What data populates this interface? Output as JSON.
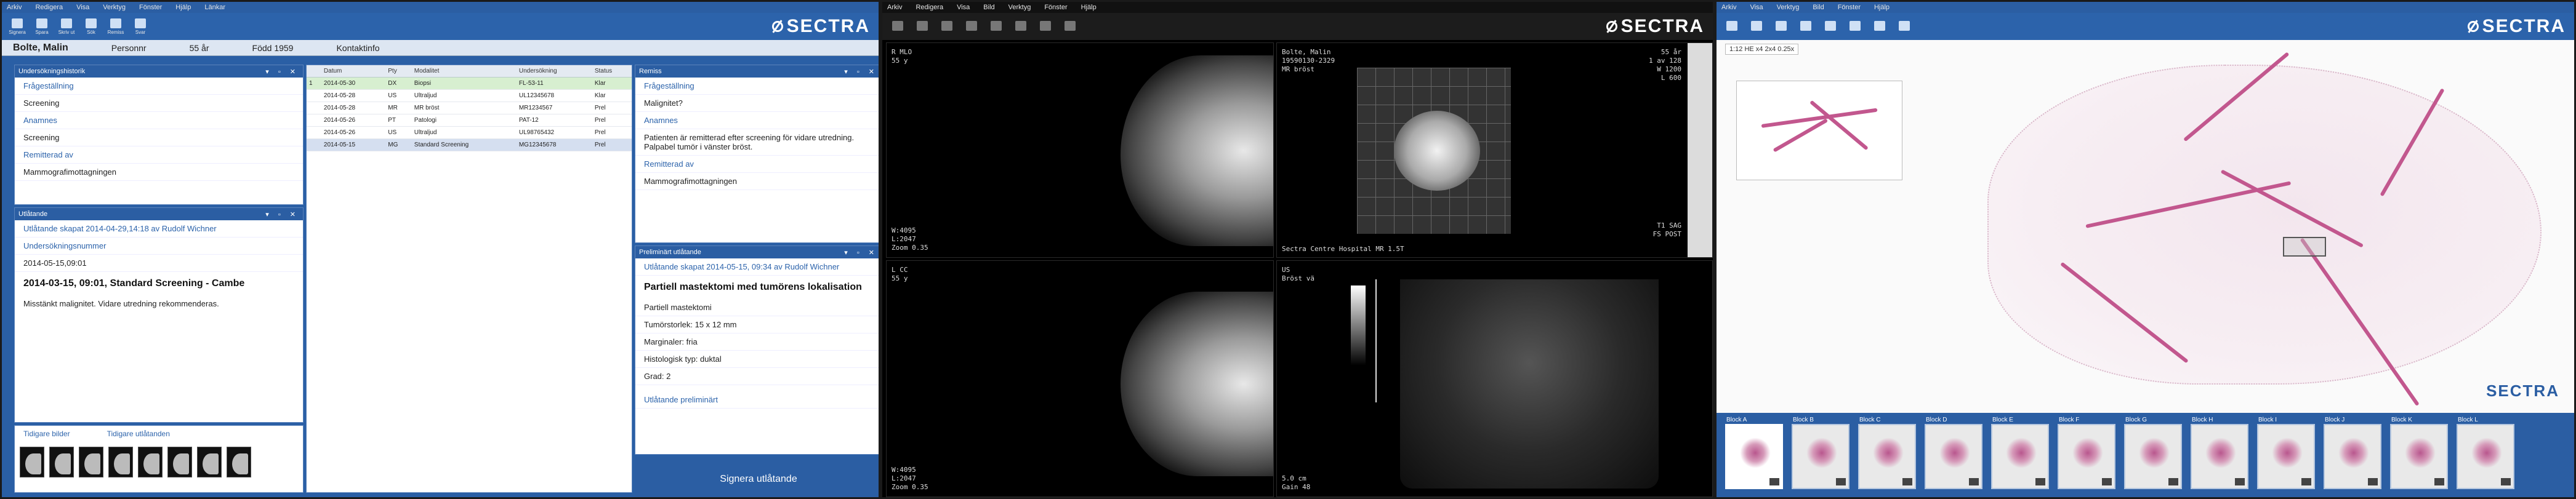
{
  "ris": {
    "menu": [
      "Arkiv",
      "Redigera",
      "Visa",
      "Verktyg",
      "Fönster",
      "Hjälp",
      "Länkar"
    ],
    "toolbar": [
      "Signera",
      "Spara",
      "Skriv ut",
      "Sök",
      "Remiss",
      "Svar"
    ],
    "patient": {
      "name": "Bolte, Malin",
      "id": "Personnr",
      "age": "55 år",
      "born": "Född 1959",
      "extra": "Kontaktinfo"
    },
    "brand": "SECTRA",
    "left_pane": {
      "title": "Undersökningshistorik",
      "items": [
        {
          "label": "Frågeställning",
          "link": true
        },
        {
          "label": "Screening",
          "link": false
        },
        {
          "label": "Anamnes",
          "link": true
        },
        {
          "label": "Screening",
          "link": false
        },
        {
          "label": "Remitterad av",
          "link": true
        },
        {
          "label": "Mammografimottagningen",
          "link": false
        }
      ]
    },
    "report_pane": {
      "title": "Utlåtande",
      "signed_by": "Utlåtande skapat 2014-04-29,14:18 av Rudolf Wichner",
      "exam_label": "Undersökningsnummer",
      "exam_no": "2014-05-15,09:01",
      "heading": "2014-03-15, 09:01, Standard Screening - Cambe",
      "body": "Misstänkt malignitet. Vidare utredning rekommenderas."
    },
    "bottom_pane": {
      "left": "Tidigare bilder",
      "right": "Tidigare utlåtanden"
    },
    "table": {
      "columns": [
        "",
        "Datum",
        "Pty",
        "Modalitet",
        "Undersökning",
        "Status"
      ],
      "rows": [
        [
          "1",
          "2014-05-30",
          "DX",
          "Biopsi",
          "FL-53-11",
          "Klar"
        ],
        [
          "",
          "2014-05-28",
          "US",
          "Ultraljud",
          "UL12345678",
          "Klar"
        ],
        [
          "",
          "2014-05-28",
          "MR",
          "MR bröst",
          "MR1234567",
          "Prel"
        ],
        [
          "",
          "2014-05-26",
          "PT",
          "Patologi",
          "PAT-12",
          "Prel"
        ],
        [
          "",
          "2014-05-26",
          "US",
          "Ultraljud",
          "UL98765432",
          "Prel"
        ],
        [
          "",
          "2014-05-15",
          "MG",
          "Standard Screening",
          "MG12345678",
          "Prel"
        ]
      ]
    },
    "right_pane": {
      "title": "Remiss",
      "items": [
        {
          "label": "Frågeställning",
          "link": true
        },
        {
          "label": "Malignitet?",
          "link": false
        },
        {
          "label": "Anamnes",
          "link": true
        },
        {
          "label": "Patienten är remitterad efter screening för vidare utredning. Palpabel tumör i vänster bröst.",
          "link": false
        },
        {
          "label": "Remitterad av",
          "link": true
        },
        {
          "label": "Mammografimottagningen",
          "link": false
        }
      ]
    },
    "right_report": {
      "title": "Preliminärt utlåtande",
      "subtitle": "Utlåtande skapat 2014-05-15, 09:34 av Rudolf Wichner",
      "heading": "Partiell mastektomi med tumörens lokalisation",
      "lines": [
        "Partiell mastektomi",
        "Tumörstorlek: 15 x 12 mm",
        "Marginaler: fria",
        "Histologisk typ: duktal",
        "Grad: 2"
      ],
      "footer": "Utlåtande preliminärt"
    },
    "sign_button": "Signera utlåtande"
  },
  "pacs": {
    "menu": [
      "Arkiv",
      "Redigera",
      "Visa",
      "Bild",
      "Verktyg",
      "Fönster",
      "Hjälp"
    ],
    "brand": "SECTRA",
    "vp1": {
      "tl": [
        "R MLO",
        "55 y"
      ],
      "bl": [
        "W:4095",
        "L:2047",
        "Zoom 0.35"
      ]
    },
    "vp2": {
      "tl": [
        "Bolte, Malin",
        "19590130-2329",
        "MR bröst"
      ],
      "tr": [
        "55 år",
        "1 av 128",
        "W 1200",
        "L 600"
      ],
      "br": [
        "T1 SAG",
        "FS POST"
      ],
      "bottom": "Sectra Centre Hospital  MR 1.5T"
    },
    "vp3": {
      "tl": [
        "L CC",
        "55 y"
      ],
      "bl": [
        "W:4095",
        "L:2047",
        "Zoom 0.35"
      ]
    },
    "vp4": {
      "tl": [
        "US",
        "Bröst vä"
      ],
      "bl": [
        "5.0 cm",
        "Gain 48"
      ]
    }
  },
  "pathology": {
    "menu": [
      "Arkiv",
      "Visa",
      "Verktyg",
      "Bild",
      "Fönster",
      "Hjälp"
    ],
    "brand": "SECTRA",
    "scale": "1:12 HE  x4  2x4  0.25x",
    "slides": [
      "Block A",
      "Block B",
      "Block C",
      "Block D",
      "Block E",
      "Block F",
      "Block G",
      "Block H",
      "Block I",
      "Block J",
      "Block K",
      "Block L"
    ],
    "watermark": "SECTRA"
  },
  "colors": {
    "ris_blue": "#2b5ea3",
    "stain_pink": "#c2578e"
  }
}
